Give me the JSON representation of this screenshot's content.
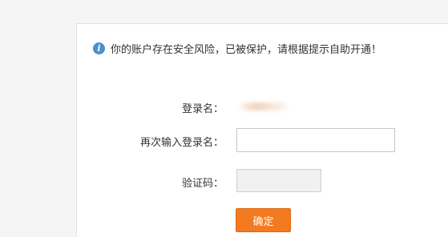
{
  "notice": {
    "icon": "info-icon",
    "icon_glyph": "i",
    "text": "你的账户存在安全风险，已被保护，请根据提示自助开通！"
  },
  "form": {
    "username_label": "登录名：",
    "reenter_label": "再次输入登录名：",
    "reenter_value": "",
    "captcha_label": "验证码：",
    "captcha_value": "",
    "confirm_label": "确定"
  },
  "colors": {
    "accent": "#f37a20",
    "info": "#4a90d0"
  }
}
